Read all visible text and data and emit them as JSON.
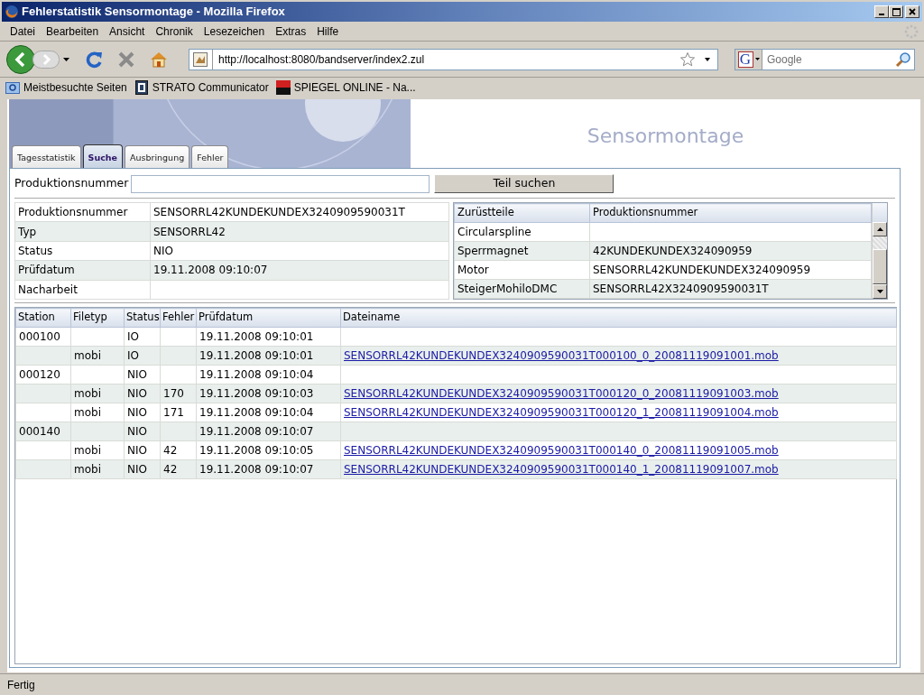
{
  "window": {
    "title": "Fehlerstatistik Sensormontage - Mozilla Firefox"
  },
  "menu": [
    "Datei",
    "Bearbeiten",
    "Ansicht",
    "Chronik",
    "Lesezeichen",
    "Extras",
    "Hilfe"
  ],
  "toolbar": {
    "url": "http://localhost:8080/bandserver/index2.zul",
    "search_engine": "G",
    "search_placeholder": "Google"
  },
  "bookmarks": [
    {
      "label": "Meistbesuchte Seiten",
      "kind": "folder"
    },
    {
      "label": "STRATO Communicator",
      "kind": "app"
    },
    {
      "label": "SPIEGEL ONLINE - Na...",
      "kind": "news"
    }
  ],
  "page": {
    "title": "Sensormontage",
    "tabs": [
      {
        "label": "Tagesstatistik",
        "selected": false
      },
      {
        "label": "Suche",
        "selected": true
      },
      {
        "label": "Ausbringung",
        "selected": false
      },
      {
        "label": "Fehler",
        "selected": false
      }
    ],
    "search": {
      "label": "Produktionsnummer",
      "button": "Teil suchen"
    },
    "details": [
      {
        "label": "Produktionsnummer",
        "value": "SENSORRL42KUNDEKUNDEX3240909590031T"
      },
      {
        "label": "Typ",
        "value": "SENSORRL42"
      },
      {
        "label": "Status",
        "value": "NIO"
      },
      {
        "label": "Prüfdatum",
        "value": "19.11.2008 09:10:07"
      },
      {
        "label": "Nacharbeit"
      }
    ],
    "parts": {
      "columns": [
        "Zurüstteile",
        "Produktionsnummer"
      ],
      "rows": [
        {
          "part": "Circularspline"
        },
        {
          "part": "Sperrmagnet",
          "number": "42KUNDEKUNDEX324090959"
        },
        {
          "part": "Motor",
          "number": "SENSORRL42KUNDEKUNDEX324090959"
        },
        {
          "part": "SteigerMohiloDMC",
          "number": "SENSORRL42X3240909590031T"
        }
      ]
    },
    "results": {
      "columns": [
        "Station",
        "Filetyp",
        "Status",
        "Fehler",
        "Prüfdatum",
        "Dateiname"
      ],
      "rows": [
        {
          "station": "000100",
          "status": "IO",
          "date": "19.11.2008 09:10:01"
        },
        {
          "filetype": "mobi",
          "status": "IO",
          "date": "19.11.2008 09:10:01",
          "file": "SENSORRL42KUNDEKUNDEX3240909590031T000100_0_20081119091001.mob"
        },
        {
          "station": "000120",
          "status": "NIO",
          "date": "19.11.2008 09:10:04"
        },
        {
          "filetype": "mobi",
          "status": "NIO",
          "errors": "170",
          "date": "19.11.2008 09:10:03",
          "file": "SENSORRL42KUNDEKUNDEX3240909590031T000120_0_20081119091003.mob"
        },
        {
          "filetype": "mobi",
          "status": "NIO",
          "errors": "171",
          "date": "19.11.2008 09:10:04",
          "file": "SENSORRL42KUNDEKUNDEX3240909590031T000120_1_20081119091004.mob"
        },
        {
          "station": "000140",
          "status": "NIO",
          "date": "19.11.2008 09:10:07"
        },
        {
          "filetype": "mobi",
          "status": "NIO",
          "errors": "42",
          "date": "19.11.2008 09:10:05",
          "file": "SENSORRL42KUNDEKUNDEX3240909590031T000140_0_20081119091005.mob"
        },
        {
          "filetype": "mobi",
          "status": "NIO",
          "errors": "42",
          "date": "19.11.2008 09:10:07",
          "file": "SENSORRL42KUNDEKUNDEX3240909590031T000140_1_20081119091007.mob"
        }
      ]
    }
  },
  "status_bar": "Fertig"
}
